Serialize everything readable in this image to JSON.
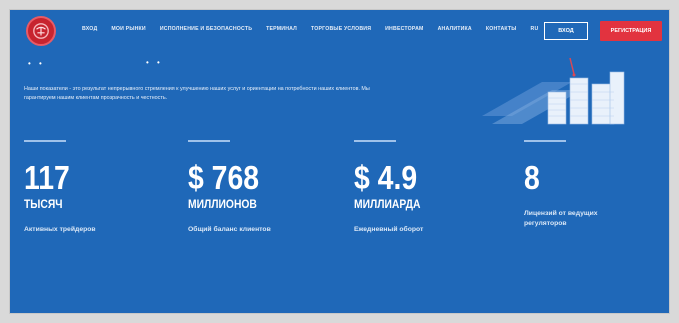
{
  "header": {
    "nav_items": [
      "Вход",
      "Мои рынки",
      "Исполнение и безопасность",
      "Терминал",
      "Торговые условия",
      "Инвесторам",
      "Аналитика",
      "Контакты",
      "RU"
    ],
    "login_label": "ВХОД",
    "register_label": "РЕГИСТРАЦИЯ"
  },
  "slider": {
    "dots_left": "• •",
    "dots_mid": "• •"
  },
  "intro": {
    "text": "Наши показатели - это результат непрерывного стремления к улучшению наших услуг и ориентации на потребности наших клиентов. Мы гарантируем нашим клиентам прозрачность и честность."
  },
  "stats": [
    {
      "value": "117",
      "unit": "ТЫСЯЧ",
      "description": "Активных трейдеров"
    },
    {
      "value": "$ 768",
      "unit": "МИЛЛИОНОВ",
      "description": "Общий баланс клиентов"
    },
    {
      "value": "$ 4.9",
      "unit": "МИЛЛИАРДА",
      "description": "Ежедневный оборот"
    },
    {
      "value": "8",
      "unit": "",
      "description": "Лицензий от ведущих регуляторов"
    }
  ],
  "colors": {
    "background": "#1f68b8",
    "accent": "#e2333f",
    "text": "#ffffff"
  },
  "icons": {
    "logo": "bull-emblem-icon",
    "illustration": "stacked-documents-icon"
  }
}
